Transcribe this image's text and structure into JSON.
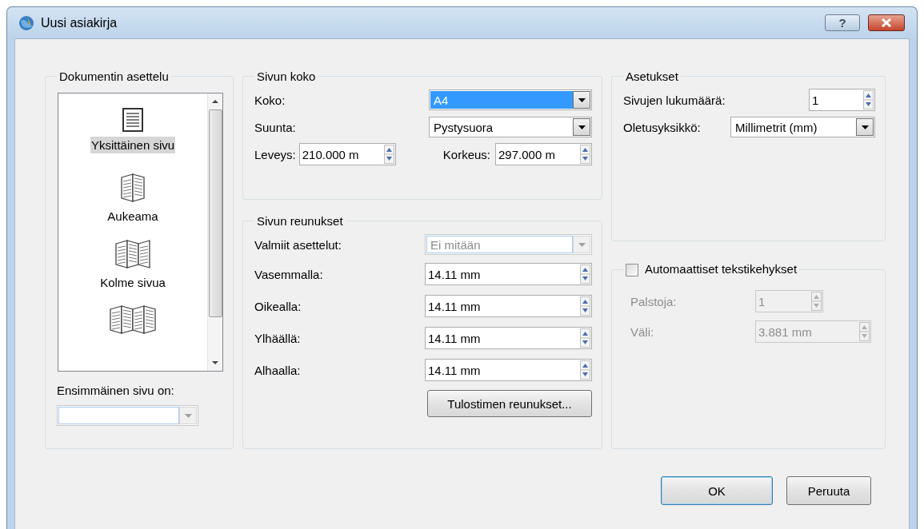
{
  "window": {
    "title": "Uusi asiakirja",
    "help_button": "?"
  },
  "layout_group": {
    "title": "Dokumentin asettelu",
    "items": [
      {
        "kind": "single",
        "label": "Yksittäinen sivu",
        "selected": true
      },
      {
        "kind": "spread",
        "label": "Aukeama",
        "selected": false
      },
      {
        "kind": "three",
        "label": "Kolme sivua",
        "selected": false
      },
      {
        "kind": "four",
        "selected": false
      }
    ],
    "first_page_label": "Ensimmäinen sivu on:",
    "first_page": {
      "disabled": true
    }
  },
  "page_size": {
    "title": "Sivun koko",
    "size": {
      "label": "Koko:",
      "value": "A4",
      "focused": true
    },
    "orientation": {
      "label": "Suunta:",
      "value": "Pystysuora",
      "focused": false
    },
    "width": {
      "label": "Leveys:",
      "value": "210.000 m"
    },
    "height": {
      "label": "Korkeus:",
      "value": "297.000 m"
    }
  },
  "margins": {
    "title": "Sivun reunukset",
    "preset": {
      "label": "Valmiit asettelut:",
      "value": "Ei mitään",
      "disabled": true
    },
    "fields": [
      {
        "label": "Vasemmalla:",
        "value": "14.11 mm"
      },
      {
        "label": "Oikealla:",
        "value": "14.11 mm"
      },
      {
        "label": "Ylhäällä:",
        "value": "14.11 mm"
      },
      {
        "label": "Alhaalla:",
        "value": "14.11 mm"
      }
    ],
    "printer_button": "Tulostimen reunukset..."
  },
  "settings": {
    "title": "Asetukset",
    "pages": {
      "label": "Sivujen lukumäärä:",
      "value": "1"
    },
    "unit": {
      "label": "Oletusyksikkö:",
      "value": "Millimetrit (mm)"
    }
  },
  "auto_frames": {
    "title": "Automaattiset tekstikehykset",
    "checked": false,
    "fields": [
      {
        "label": "Palstoja:",
        "value": "1",
        "disabled": true
      },
      {
        "label": "Väli:",
        "value": "3.881 mm",
        "disabled": true
      }
    ]
  },
  "buttons": [
    {
      "label": "OK",
      "default": true
    },
    {
      "label": "Peruuta",
      "default": false
    }
  ]
}
